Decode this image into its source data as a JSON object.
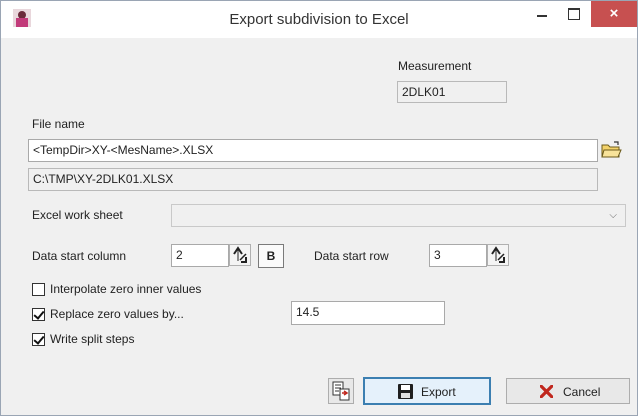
{
  "window": {
    "title": "Export subdivision to Excel",
    "close_glyph": "×"
  },
  "measurement": {
    "label": "Measurement",
    "value": "2DLK01"
  },
  "file": {
    "label": "File name",
    "template": "<TempDir>XY-<MesName>.XLSX",
    "resolved": "C:\\TMP\\XY-2DLK01.XLSX"
  },
  "worksheet": {
    "label": "Excel work sheet",
    "value": ""
  },
  "data_start_column": {
    "label": "Data start column",
    "value": "2",
    "b_button": "B"
  },
  "data_start_row": {
    "label": "Data start row",
    "value": "3"
  },
  "options": {
    "interpolate": {
      "label": "Interpolate zero inner values",
      "checked": false
    },
    "replace_zero": {
      "label": "Replace zero values by...",
      "checked": true,
      "value": "14.5"
    },
    "write_split": {
      "label": "Write split steps",
      "checked": true
    }
  },
  "buttons": {
    "export": "Export",
    "cancel": "Cancel"
  },
  "colors": {
    "close_bg": "#c75050",
    "default_border": "#3c7fb1",
    "cancel_x": "#c0271e"
  }
}
